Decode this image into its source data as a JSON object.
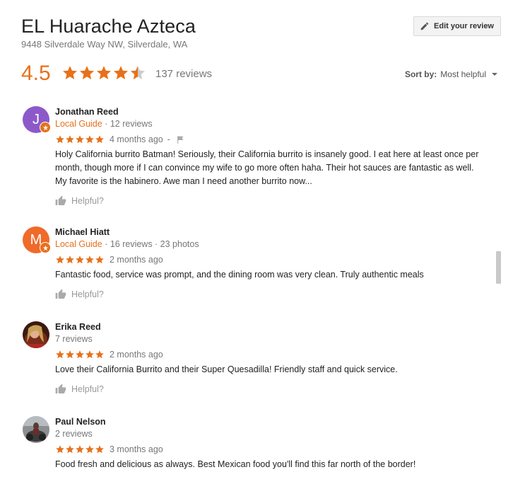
{
  "header": {
    "title": "EL Huarache Azteca",
    "address": "9448 Silverdale Way NW, Silverdale, WA",
    "edit_button_label": "Edit your review"
  },
  "summary": {
    "rating": "4.5",
    "stars": 4.5,
    "review_count": "137 reviews",
    "sort_label": "Sort by:",
    "sort_value": "Most helpful"
  },
  "colors": {
    "accent": "#e7711b",
    "avatar_jonathan": "#8d59c9",
    "avatar_michael": "#f06a2a"
  },
  "reviews": [
    {
      "name": "Jonathan Reed",
      "avatar_letter": "J",
      "local_guide": "Local Guide",
      "meta": " · 12 reviews",
      "stars": 5,
      "date": "4 months ago",
      "dash": "-",
      "text": "Holy California burrito Batman! Seriously, their California burrito is insanely good. I eat here at least once per month, though more if I can convince my wife to go more often haha. Their hot sauces are fantastic as well. My favorite is the habinero. Awe man I need another burrito now...",
      "helpful": "Helpful?"
    },
    {
      "name": "Michael Hiatt",
      "avatar_letter": "M",
      "local_guide": "Local Guide",
      "meta": " · 16 reviews · 23 photos",
      "stars": 5,
      "date": "2 months ago",
      "text": "Fantastic food, service was prompt, and the dining room was very clean. Truly authentic meals",
      "helpful": "Helpful?"
    },
    {
      "name": "Erika Reed",
      "meta": "7 reviews",
      "stars": 5,
      "date": "2 months ago",
      "text": "Love their California Burrito and their Super Quesadilla! Friendly staff and quick service.",
      "helpful": "Helpful?"
    },
    {
      "name": "Paul Nelson",
      "meta": "2 reviews",
      "stars": 5,
      "date": "3 months ago",
      "text": "Food fresh and delicious as always. Best Mexican food you'll find this far north of the border!"
    }
  ]
}
